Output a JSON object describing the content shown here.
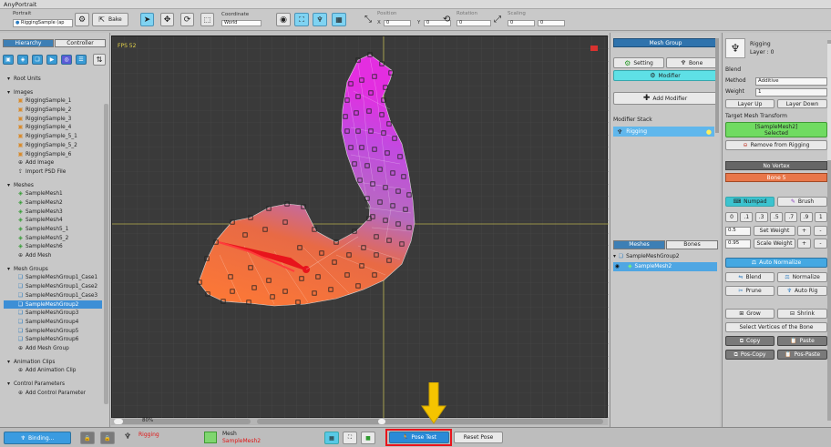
{
  "window": {
    "title": "AnyPortrait"
  },
  "toolbar": {
    "portrait_label": "Portrait",
    "portrait_name": "RiggingSample (ap",
    "bake_label": "Bake",
    "coordinate_label": "Coordinate",
    "coordinate_value": "World",
    "position_label": "Position",
    "rotation_label": "Rotation",
    "scaling_label": "Scaling",
    "x_label": "X",
    "y_label": "Y",
    "pos_x": "0",
    "pos_y": "0",
    "rot": "0",
    "scale_x": "0",
    "scale_y": "0"
  },
  "left": {
    "tabs": [
      "Hierarchy",
      "Controller"
    ],
    "tree": [
      {
        "type": "head",
        "label": "Root Units"
      },
      {
        "type": "gap"
      },
      {
        "type": "head",
        "label": "Images"
      },
      {
        "type": "child",
        "icon": "image",
        "label": "RiggingSample_1"
      },
      {
        "type": "child",
        "icon": "image",
        "label": "RiggingSample_2"
      },
      {
        "type": "child",
        "icon": "image",
        "label": "RiggingSample_3"
      },
      {
        "type": "child",
        "icon": "image",
        "label": "RiggingSample_4"
      },
      {
        "type": "child",
        "icon": "image",
        "label": "RiggingSample_5_1"
      },
      {
        "type": "child",
        "icon": "image",
        "label": "RiggingSample_5_2"
      },
      {
        "type": "child",
        "icon": "image",
        "label": "RiggingSample_6"
      },
      {
        "type": "child",
        "icon": "add",
        "label": "Add Image"
      },
      {
        "type": "child",
        "icon": "import",
        "label": "Import PSD File"
      },
      {
        "type": "gap"
      },
      {
        "type": "head",
        "label": "Meshes"
      },
      {
        "type": "child",
        "icon": "mesh",
        "label": "SampleMesh1"
      },
      {
        "type": "child",
        "icon": "mesh",
        "label": "SampleMesh2"
      },
      {
        "type": "child",
        "icon": "mesh",
        "label": "SampleMesh3"
      },
      {
        "type": "child",
        "icon": "mesh",
        "label": "SampleMesh4"
      },
      {
        "type": "child",
        "icon": "mesh",
        "label": "SampleMesh5_1"
      },
      {
        "type": "child",
        "icon": "mesh",
        "label": "SampleMesh5_2"
      },
      {
        "type": "child",
        "icon": "mesh",
        "label": "SampleMesh6"
      },
      {
        "type": "child",
        "icon": "add",
        "label": "Add Mesh"
      },
      {
        "type": "gap"
      },
      {
        "type": "head",
        "label": "Mesh Groups"
      },
      {
        "type": "child",
        "icon": "group",
        "label": "SampleMeshGroup1_Case1"
      },
      {
        "type": "child",
        "icon": "group",
        "label": "SampleMeshGroup1_Case2"
      },
      {
        "type": "child",
        "icon": "group",
        "label": "SampleMeshGroup1_Case3"
      },
      {
        "type": "child",
        "icon": "group",
        "label": "SampleMeshGroup2",
        "selected": true
      },
      {
        "type": "child",
        "icon": "group",
        "label": "SampleMeshGroup3"
      },
      {
        "type": "child",
        "icon": "group",
        "label": "SampleMeshGroup4"
      },
      {
        "type": "child",
        "icon": "group",
        "label": "SampleMeshGroup5"
      },
      {
        "type": "child",
        "icon": "group",
        "label": "SampleMeshGroup6"
      },
      {
        "type": "child",
        "icon": "add",
        "label": "Add Mesh Group"
      },
      {
        "type": "gap"
      },
      {
        "type": "head",
        "label": "Animation Clips"
      },
      {
        "type": "child",
        "icon": "add",
        "label": "Add Animation Clip"
      },
      {
        "type": "gap"
      },
      {
        "type": "head",
        "label": "Control Parameters"
      },
      {
        "type": "child",
        "icon": "add",
        "label": "Add Control Parameter"
      }
    ]
  },
  "viewport": {
    "fps": "FPS 52",
    "zoom": "80%"
  },
  "meshgroup": {
    "header": "Mesh Group",
    "setting_label": "Setting",
    "bone_label": "Bone",
    "modifier_label": "Modifier",
    "add_modifier_label": "Add Modifier",
    "modifier_stack_label": "Modifier Stack",
    "stack_item": "Rigging",
    "tab_meshes": "Meshes",
    "tab_bones": "Bones",
    "group_name": "SampleMeshGroup2",
    "mesh_name": "SampleMesh2"
  },
  "inspector": {
    "title": "Rigging",
    "layer": "Layer : 0",
    "blend_label": "Blend",
    "method_label": "Method",
    "method_value": "Additive",
    "weight_label": "Weight",
    "weight_value": "1",
    "layer_up": "Layer Up",
    "layer_down": "Layer Down",
    "target_label": "Target Mesh Transform",
    "target_name": "[SampleMesh2]",
    "target_state": "Selected",
    "remove_label": "Remove from Rigging",
    "no_vertex": "No Vertex",
    "bone_label": "Bone 5",
    "numpad_label": "Numpad",
    "brush_label": "Brush",
    "numpad_values": [
      "0",
      ".1",
      ".3",
      ".5",
      ".7",
      ".9",
      "1"
    ],
    "set_weight_value": "0.5",
    "set_weight_label": "Set Weight",
    "scale_weight_value": "0.95",
    "scale_weight_label": "Scale Weight",
    "plus": "+",
    "minus": "-",
    "auto_normalize": "Auto Normalize",
    "blend_btn": "Blend",
    "normalize_btn": "Normalize",
    "prune_btn": "Prune",
    "auto_rig_btn": "Auto Rig",
    "grow_btn": "Grow",
    "shrink_btn": "Shrink",
    "select_vertices_btn": "Select Vertices of the Bone",
    "copy_btn": "Copy",
    "paste_btn": "Paste",
    "pos_copy_btn": "Pos-Copy",
    "pos_paste_btn": "Pos-Paste"
  },
  "bottom": {
    "binding_label": "Binding...",
    "rigging_label": "Rigging",
    "mesh_label": "Mesh",
    "mesh_name": "SampleMesh2",
    "pose_test_label": "Pose Test",
    "reset_pose_label": "Reset Pose"
  },
  "colors": {
    "accent": "#2f73ad",
    "highlight": "#e8141c",
    "arrow": "#f5c400",
    "cyan": "#5ee0e6"
  }
}
